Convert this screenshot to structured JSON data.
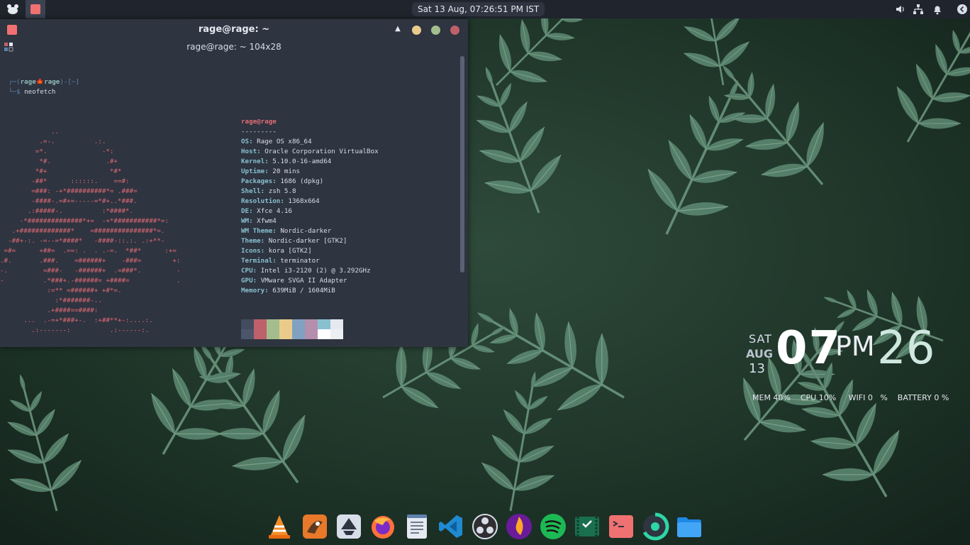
{
  "top_panel": {
    "clock": "Sat 13 Aug, 07:26:51 PM IST"
  },
  "terminal": {
    "window_title": "rage@rage: ~",
    "tab_title": "rage@rage: ~ 104x28",
    "prompt": {
      "open": "┌─(",
      "user": "rage",
      "leaf": "🍁",
      "host": "rage",
      "close": ")-[~]",
      "cmd_prefix": "└─$ ",
      "command": "neofetch"
    },
    "ascii_art": "             ..\n          .=-.          .:.\n         =*.              -*:\n          *#.              .#+\n         *#+                *#*\n        -##*      ::::::.    ==#:\n        =###: -+*##########*= .###=\n        -####-.=#+=-----=*#+..*###.\n       .:#####-.          :*####*.\n     -*##############*+=  -+*###########*=:\n   .+#############*    =###############*=.\n  -##+-:. -=--=*####*   -####-::.:. .:+**-\n =#=      +##=  .==: .  . .-=.  *##*      :+=\n.#.       .###.    =######+    -###=        +:\n-.         =###-   -######+  .=###*.         -\n-          .*###+.-######= +####=            .\n            :=** =######+ +#*=.\n              :*#######-..\n            .+####==####:\n      ...  .-=+*###+-.  :+##**+-:....:.\n        .:-------:          .:------:.",
    "info": {
      "userhost": "rage@rage",
      "separator": "---------",
      "rows": [
        {
          "key": "OS",
          "value": "Rage OS x86_64"
        },
        {
          "key": "Host",
          "value": "Oracle Corporation VirtualBox"
        },
        {
          "key": "Kernel",
          "value": "5.10.0-16-amd64"
        },
        {
          "key": "Uptime",
          "value": "20 mins"
        },
        {
          "key": "Packages",
          "value": "1686 (dpkg)"
        },
        {
          "key": "Shell",
          "value": "zsh 5.8"
        },
        {
          "key": "Resolution",
          "value": "1368x664"
        },
        {
          "key": "DE",
          "value": "Xfce 4.16"
        },
        {
          "key": "WM",
          "value": "Xfwm4"
        },
        {
          "key": "WM Theme",
          "value": "Nordic-darker"
        },
        {
          "key": "Theme",
          "value": "Nordic-darker [GTK2]"
        },
        {
          "key": "Icons",
          "value": "kora [GTK2]"
        },
        {
          "key": "Terminal",
          "value": "terminator"
        },
        {
          "key": "CPU",
          "value": "Intel i3-2120 (2) @ 3.292GHz"
        },
        {
          "key": "GPU",
          "value": "VMware SVGA II Adapter"
        },
        {
          "key": "Memory",
          "value": "639MiB / 1604MiB"
        }
      ]
    },
    "palette_top": [
      "#434c5e",
      "#bf616a",
      "#a3be8c",
      "#ebcb8b",
      "#81a1c1",
      "#b48ead",
      "#88c0d0",
      "#e5e9f0"
    ],
    "palette_bottom": [
      "#4c566a",
      "#bf616a",
      "#a3be8c",
      "#ebcb8b",
      "#81a1c1",
      "#b48ead",
      "#ffffff",
      "#eceff4"
    ]
  },
  "conky": {
    "day": "SAT",
    "month": "AUG",
    "date": "13",
    "hour": "07",
    "ampm": "PM",
    "minute": "26",
    "stats": "MEM 40%    CPU 10%     WIFI 0   %    BATTERY 0 %"
  },
  "dock_icons": [
    "vlc-icon",
    "gimp-icon",
    "inkscape-icon",
    "firefox-icon",
    "text-editor-icon",
    "vscode-icon",
    "obs-icon",
    "kodi-icon",
    "spotify-icon",
    "screen-recorder-icon",
    "terminal-icon",
    "disk-usage-icon",
    "files-icon"
  ]
}
